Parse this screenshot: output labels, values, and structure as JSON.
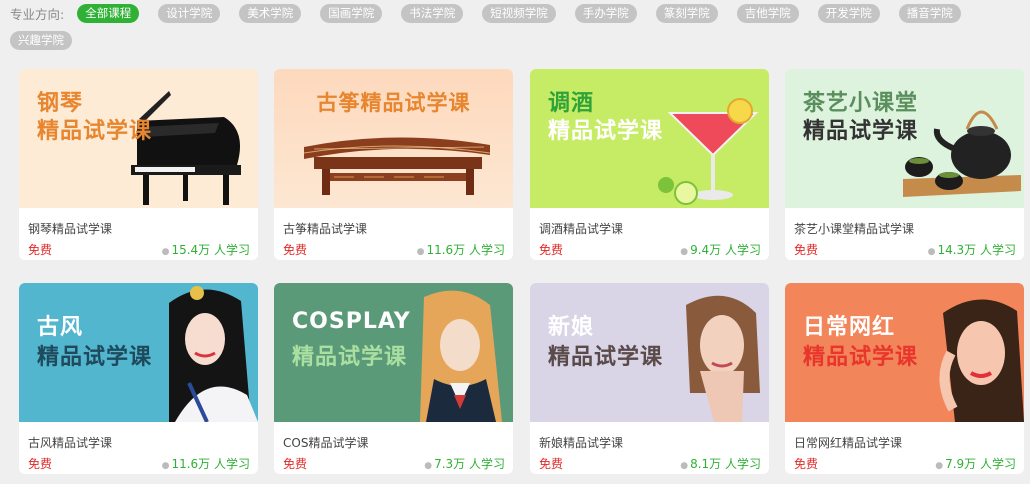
{
  "filter": {
    "label": "专业方向:",
    "chips": [
      "全部课程",
      "设计学院",
      "美术学院",
      "国画学院",
      "书法学院",
      "短视频学院",
      "手办学院",
      "篆刻学院",
      "吉他学院",
      "开发学院",
      "播音学院",
      "兴趣学院"
    ]
  },
  "colors": {
    "accent_green": "#2fb135",
    "price_red": "#e02a2a",
    "chip_gray": "#c4c4c4"
  },
  "courses": [
    {
      "banner_line1": "钢琴",
      "banner_line2": "精品试学课",
      "title": "钢琴精品试学课",
      "price": "免费",
      "learners": "15.4万 人学习",
      "art": "piano-illustration"
    },
    {
      "banner_line1": "古筝精品试学课",
      "banner_line2": "",
      "title": "古筝精品试学课",
      "price": "免费",
      "learners": "11.6万 人学习",
      "art": "guzheng-illustration"
    },
    {
      "banner_line1": "调酒",
      "banner_line2": "精品试学课",
      "title": "调酒精品试学课",
      "price": "免费",
      "learners": "9.4万 人学习",
      "art": "cocktail-illustration"
    },
    {
      "banner_line1": "茶艺小课堂",
      "banner_line2": "精品试学课",
      "title": "茶艺小课堂精品试学课",
      "price": "免费",
      "learners": "14.3万 人学习",
      "art": "teapot-illustration"
    },
    {
      "banner_line1": "古风",
      "banner_line2": "精品试学课",
      "title": "古风精品试学课",
      "price": "免费",
      "learners": "11.6万 人学习",
      "art": "hanfu-portrait"
    },
    {
      "banner_line1": "COSPLAY",
      "banner_line2": "精品试学课",
      "title": "COS精品试学课",
      "price": "免费",
      "learners": "7.3万 人学习",
      "art": "cosplay-portrait"
    },
    {
      "banner_line1": "新娘",
      "banner_line2": "精品试学课",
      "title": "新娘精品试学课",
      "price": "免费",
      "learners": "8.1万 人学习",
      "art": "bride-portrait"
    },
    {
      "banner_line1": "日常网红",
      "banner_line2": "精品试学课",
      "title": "日常网红精品试学课",
      "price": "免费",
      "learners": "7.9万 人学习",
      "art": "makeup-portrait"
    }
  ]
}
